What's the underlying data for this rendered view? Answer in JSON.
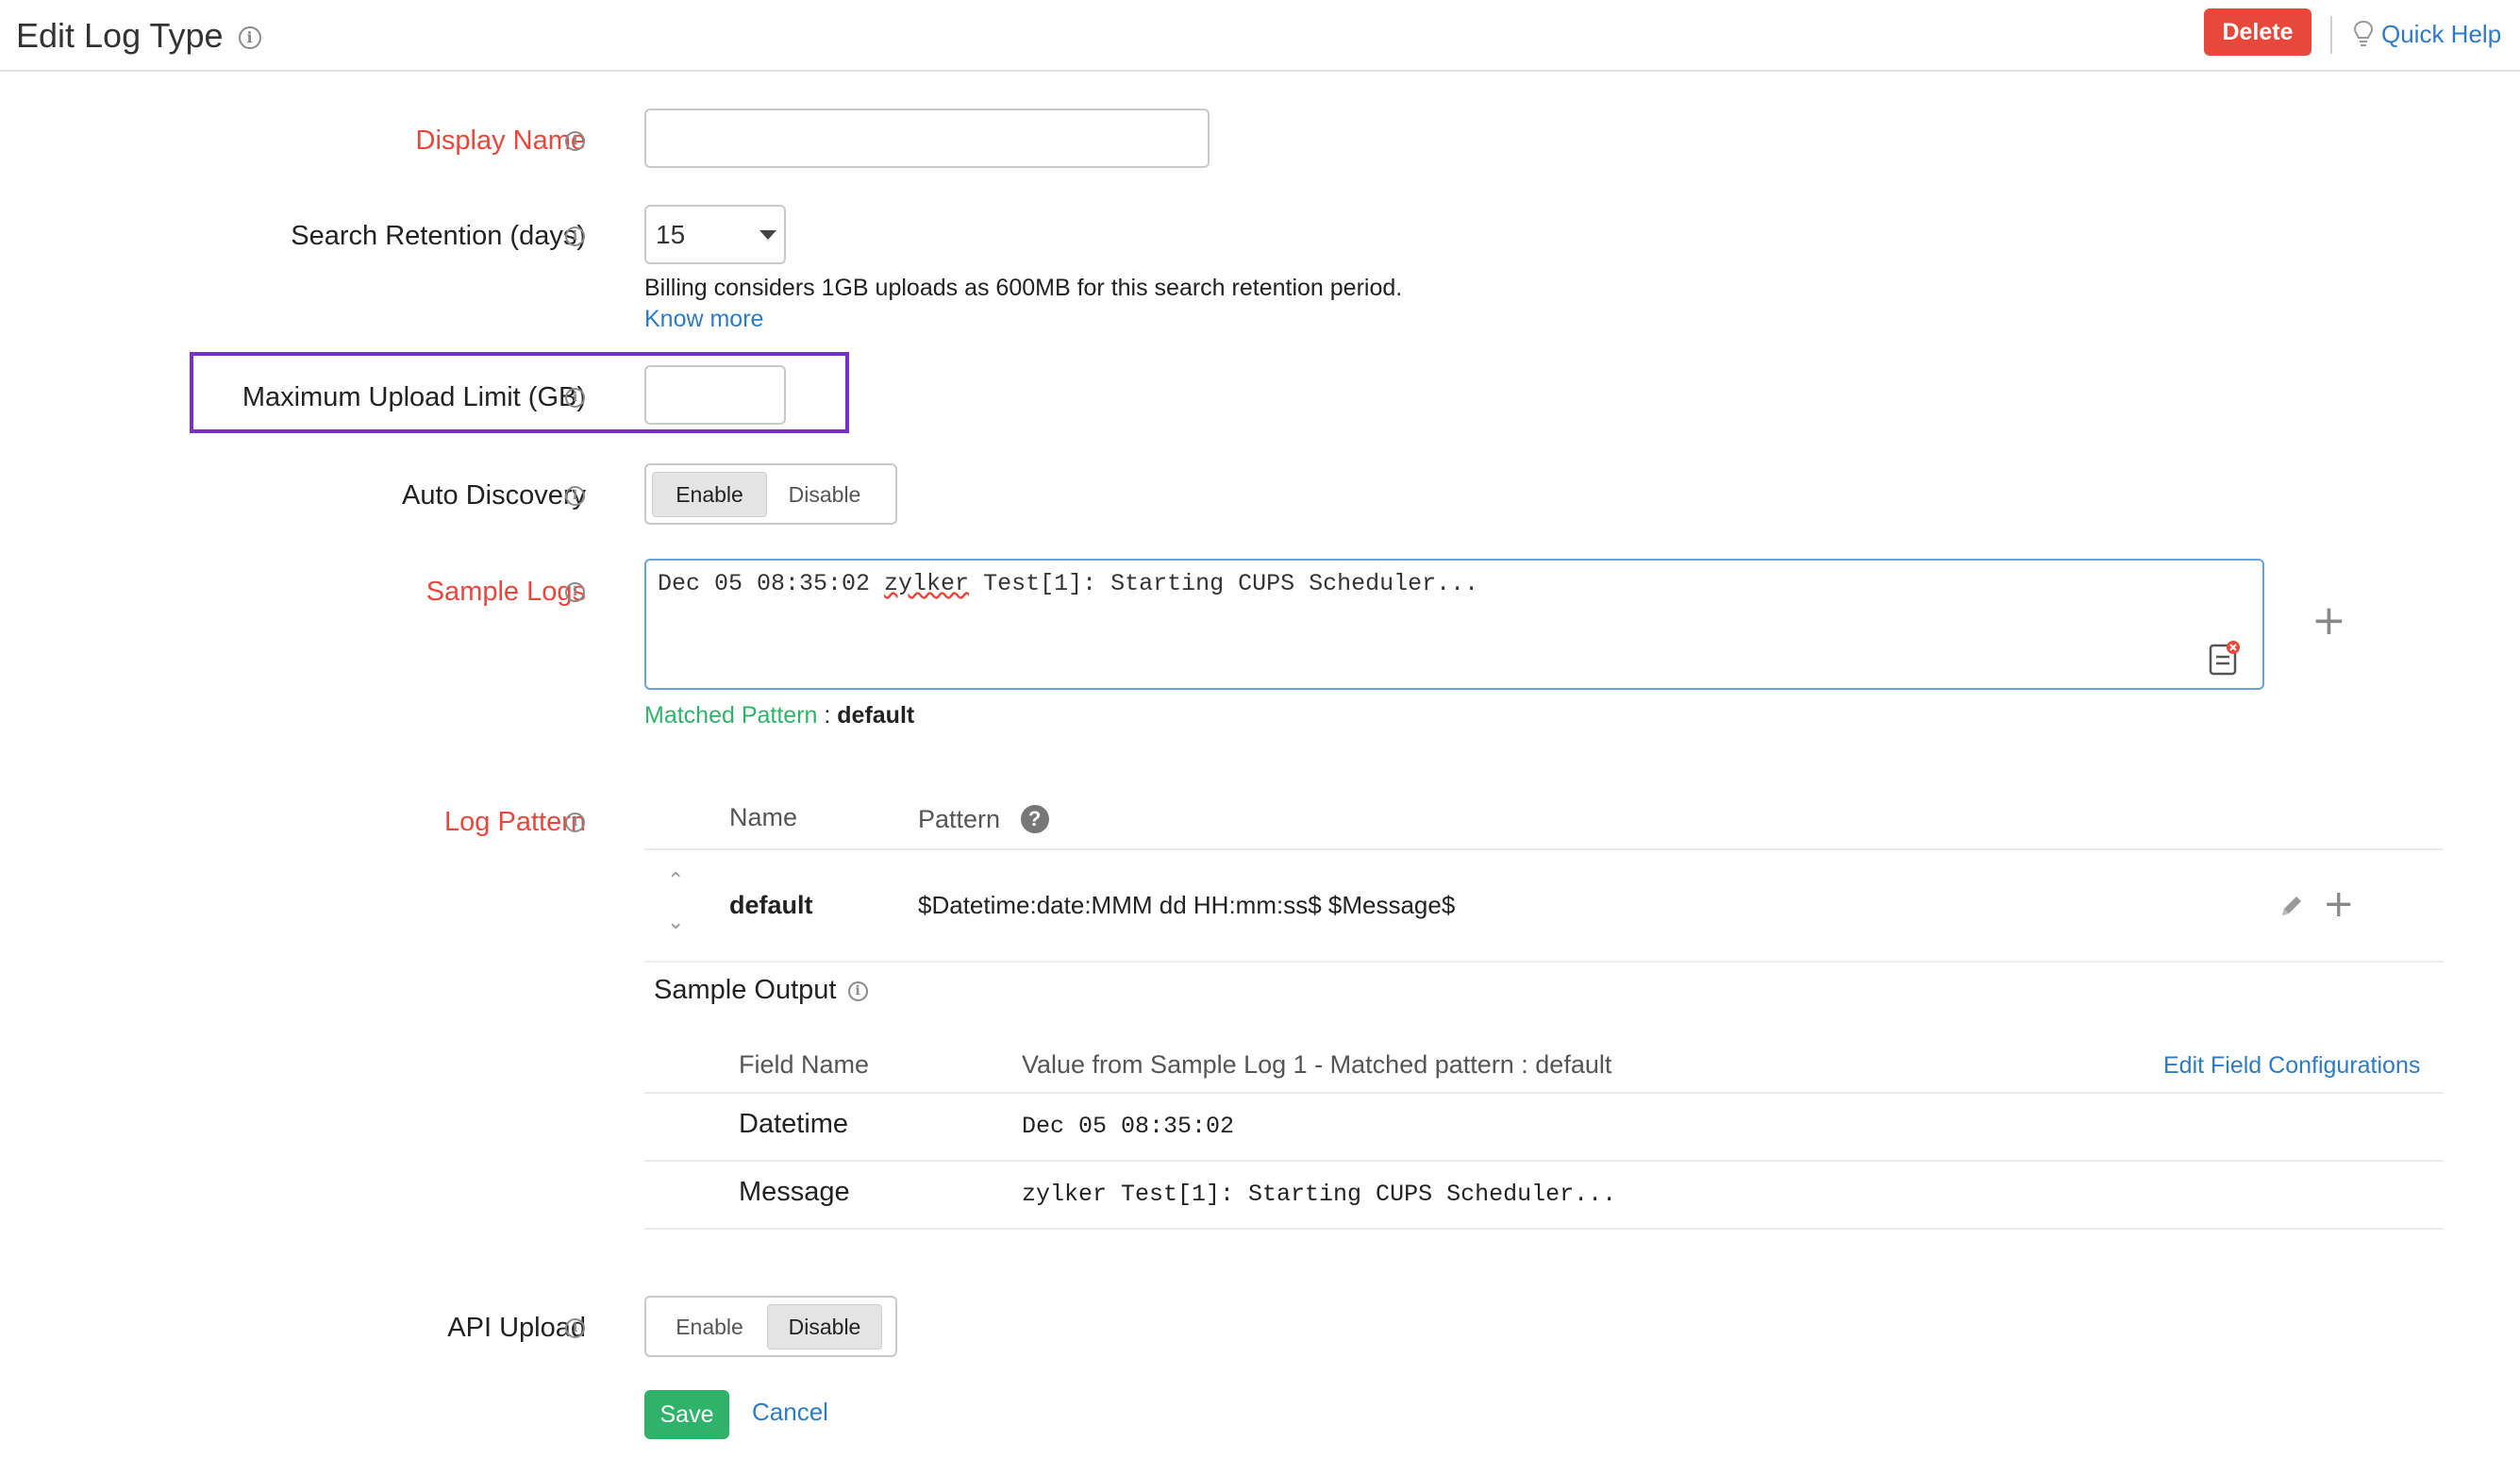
{
  "header": {
    "title": "Edit Log Type",
    "delete_label": "Delete",
    "quick_help_label": "Quick Help"
  },
  "form": {
    "display_name": {
      "label": "Display Name",
      "value": ""
    },
    "search_retention": {
      "label": "Search Retention (days)",
      "selected": "15",
      "hint": "Billing considers 1GB uploads as 600MB for this search retention period.",
      "know_more": "Know more"
    },
    "max_upload": {
      "label": "Maximum Upload Limit (GB)",
      "value": ""
    },
    "auto_discovery": {
      "label": "Auto Discovery",
      "enable": "Enable",
      "disable": "Disable",
      "selected": "Enable"
    },
    "sample_logs": {
      "label": "Sample Logs",
      "text_before": "Dec 05 08:35:02 ",
      "text_flagged": "zylker",
      "text_after": " Test[1]: Starting CUPS Scheduler...",
      "matched_label": "Matched Pattern",
      "matched_sep": " : ",
      "matched_value": "default"
    },
    "log_pattern": {
      "label": "Log Pattern",
      "columns": {
        "name": "Name",
        "pattern": "Pattern"
      },
      "rows": [
        {
          "name": "default",
          "pattern": "$Datetime:date:MMM dd HH:mm:ss$ $Message$"
        }
      ]
    },
    "sample_output": {
      "label": "Sample Output",
      "columns": {
        "field": "Field Name",
        "value": "Value from Sample Log 1 - Matched pattern : default"
      },
      "edit_link": "Edit Field Configurations",
      "rows": [
        {
          "field": "Datetime",
          "value": "Dec 05 08:35:02"
        },
        {
          "field": "Message",
          "value": "zylker Test[1]: Starting CUPS Scheduler..."
        }
      ]
    },
    "api_upload": {
      "label": "API Upload",
      "enable": "Enable",
      "disable": "Disable",
      "selected": "Disable"
    },
    "save_label": "Save",
    "cancel_label": "Cancel"
  },
  "colors": {
    "required_label": "#e8473c",
    "link": "#2e7bc4",
    "save": "#2fb36a",
    "highlight": "#7b2fc9",
    "delete": "#e8473c"
  }
}
